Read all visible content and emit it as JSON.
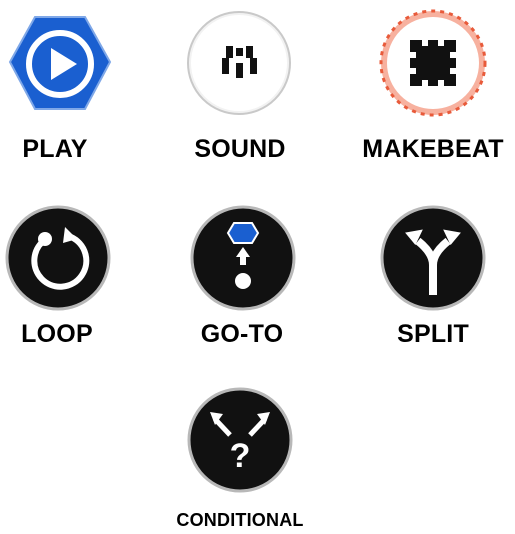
{
  "tiles": {
    "play": {
      "label": "PLAY",
      "icon": "play-icon",
      "color": "#1a5fd0"
    },
    "sound": {
      "label": "SOUND",
      "icon": "sound-icon"
    },
    "makebeat": {
      "label": "MAKEBEAT",
      "icon": "makebeat-icon",
      "accent": "#e85a3a"
    },
    "loop": {
      "label": "LOOP",
      "icon": "loop-icon"
    },
    "goto": {
      "label": "GO-TO",
      "icon": "goto-icon",
      "accent": "#1a5fd0"
    },
    "split": {
      "label": "SPLIT",
      "icon": "split-icon"
    },
    "conditional": {
      "label": "CONDITIONAL",
      "icon": "conditional-icon"
    }
  }
}
